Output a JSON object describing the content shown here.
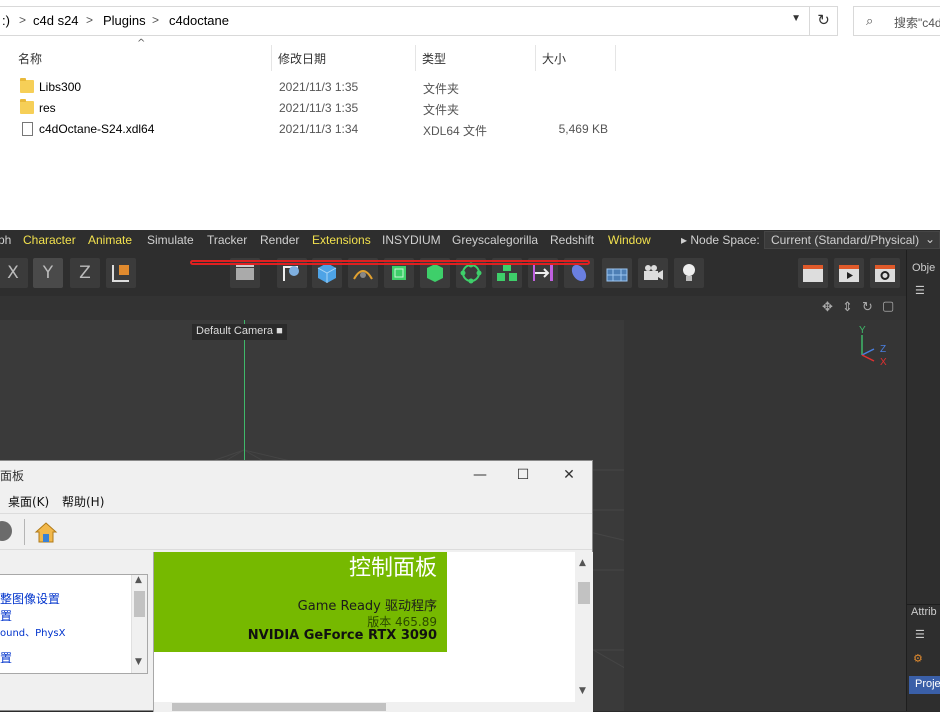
{
  "explorer": {
    "breadcrumb": [
      ":)",
      "c4d s24",
      "Plugins",
      "c4doctane"
    ],
    "breadcrumb_sep": ">",
    "search_placeholder": "搜索\"c4d",
    "columns": {
      "name": "名称",
      "date": "修改日期",
      "type": "类型",
      "size": "大小"
    },
    "files": [
      {
        "name": "Libs300",
        "date": "2021/11/3 1:35",
        "type": "文件夹",
        "size": "",
        "icon": "folder-icon"
      },
      {
        "name": "res",
        "date": "2021/11/3 1:35",
        "type": "文件夹",
        "size": "",
        "icon": "folder-icon"
      },
      {
        "name": "c4dOctane-S24.xdl64",
        "date": "2021/11/3 1:34",
        "type": "XDL64 文件",
        "size": "5,469 KB",
        "icon": "file-icon"
      }
    ]
  },
  "c4d": {
    "menu": [
      {
        "label": "ph",
        "highlight": false
      },
      {
        "label": "Character",
        "highlight": true
      },
      {
        "label": "Animate",
        "highlight": true
      },
      {
        "label": "Simulate",
        "highlight": false
      },
      {
        "label": "Tracker",
        "highlight": false
      },
      {
        "label": "Render",
        "highlight": false
      },
      {
        "label": "Extensions",
        "highlight": true
      },
      {
        "label": "INSYDIUM",
        "highlight": false
      },
      {
        "label": "Greyscalegorilla",
        "highlight": false
      },
      {
        "label": "Redshift",
        "highlight": false
      },
      {
        "label": "Window",
        "highlight": true
      }
    ],
    "node_space_label": "Node Space:",
    "node_space_value": "Current (Standard/Physical)",
    "camera_label": "Default Camera",
    "axis_labels": {
      "x": "X",
      "y": "Y",
      "z": "Z"
    },
    "right_panel": {
      "objects": "Obje",
      "attributes": "Attrib",
      "project": "Proje"
    }
  },
  "nvidia": {
    "title": "面板",
    "menu": [
      "桌面(K)",
      "帮助(H)"
    ],
    "tree_items": [
      "整图像设置",
      "置",
      "ound、PhysX",
      "置"
    ],
    "banner_title": "控制面板",
    "driver": "Game Ready 驱动程序",
    "version": "版本 465.89",
    "gpu": "NVIDIA GeForce RTX 3090"
  },
  "colors": {
    "nvidia_green": "#76b900",
    "menu_highlight": "#f2e14e",
    "axis_green": "#3fb86a"
  }
}
